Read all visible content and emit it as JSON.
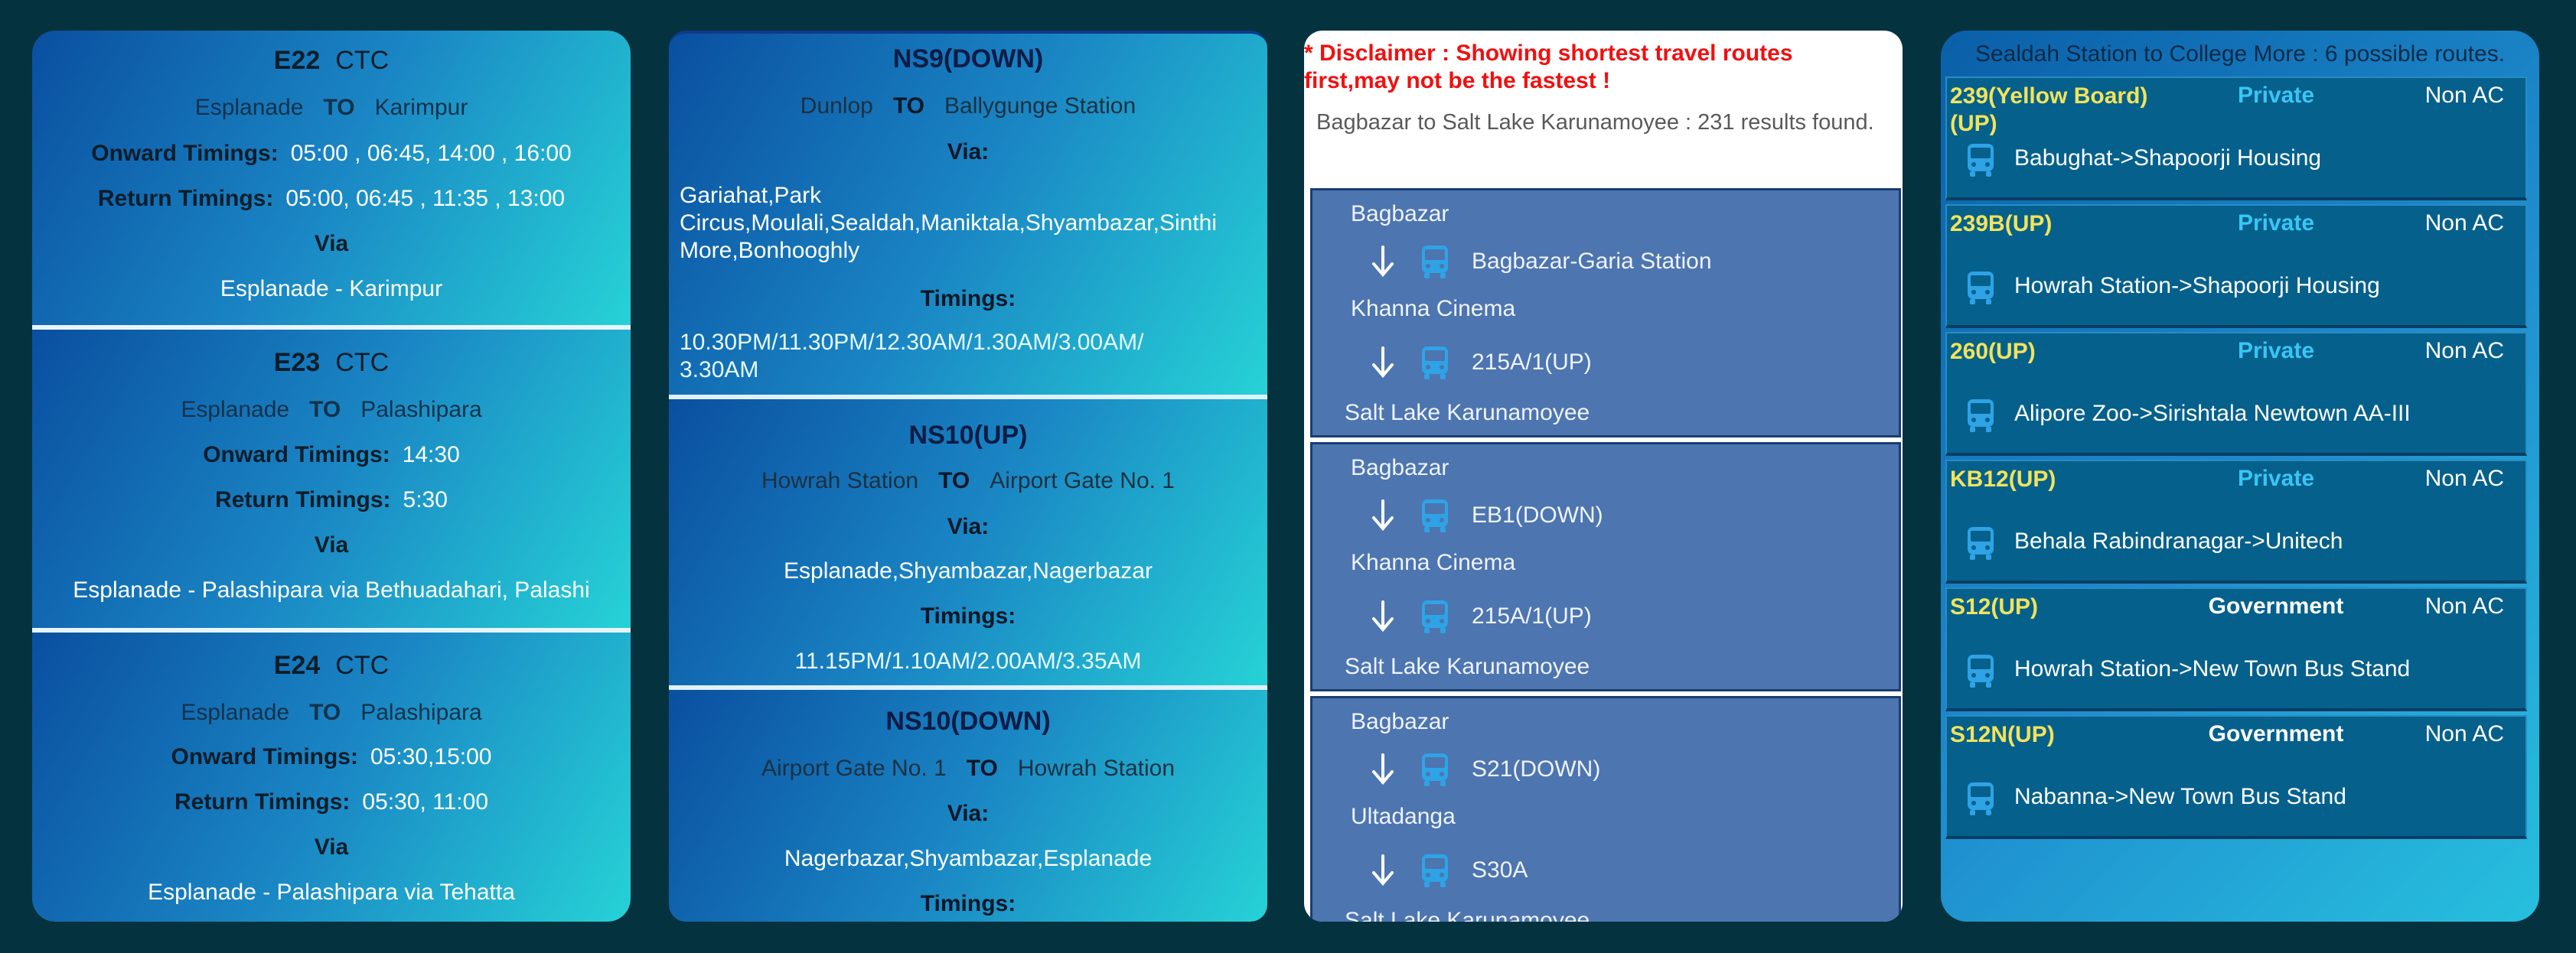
{
  "panel1": {
    "cards": [
      {
        "code": "E22",
        "operator": "CTC",
        "from": "Esplanade",
        "to_word": "TO",
        "to": "Karimpur",
        "onward_label": "Onward Timings:",
        "onward": "05:00 , 06:45, 14:00 , 16:00",
        "return_label": "Return Timings:",
        "return": "05:00, 06:45 , 11:35 , 13:00",
        "via_label": "Via",
        "via": "Esplanade - Karimpur"
      },
      {
        "code": "E23",
        "operator": "CTC",
        "from": "Esplanade",
        "to_word": "TO",
        "to": "Palashipara",
        "onward_label": "Onward Timings:",
        "onward": "14:30",
        "return_label": "Return Timings:",
        "return": "5:30",
        "via_label": "Via",
        "via": "Esplanade - Palashipara via Bethuadahari, Palashi"
      },
      {
        "code": "E24",
        "operator": "CTC",
        "from": "Esplanade",
        "to_word": "TO",
        "to": "Palashipara",
        "onward_label": "Onward Timings:",
        "onward": "05:30,15:00",
        "return_label": "Return Timings:",
        "return": "05:30, 11:00",
        "via_label": "Via",
        "via": "Esplanade - Palashipara via Tehatta"
      }
    ]
  },
  "panel2": {
    "cards": [
      {
        "title": "NS9(DOWN)",
        "from": "Dunlop",
        "to_word": "TO",
        "to": "Ballygunge Station",
        "via_label": "Via:",
        "via": "Gariahat,Park Circus,Moulali,Sealdah,Maniktala,Shyambazar,Sinthi More,Bonhooghly",
        "timings_label": "Timings:",
        "timings": "10.30PM/11.30PM/12.30AM/1.30AM/3.00AM/ 3.30AM"
      },
      {
        "title": "NS10(UP)",
        "from": "Howrah Station",
        "to_word": "TO",
        "to": "Airport Gate No. 1",
        "via_label": "Via:",
        "via": "Esplanade,Shyambazar,Nagerbazar",
        "timings_label": "Timings:",
        "timings": "11.15PM/1.10AM/2.00AM/3.35AM"
      },
      {
        "title": "NS10(DOWN)",
        "from": "Airport Gate No. 1",
        "to_word": "TO",
        "to": "Howrah Station",
        "via_label": "Via:",
        "via": "Nagerbazar,Shyambazar,Esplanade",
        "timings_label": "Timings:"
      }
    ]
  },
  "panel3": {
    "disclaimer": "* Disclaimer : Showing shortest travel routes first,may not be the fastest !",
    "results": "Bagbazar to Salt Lake Karunamoyee : 231 results found.",
    "routes": [
      {
        "stop1": "Bagbazar",
        "leg1": "Bagbazar-Garia Station",
        "stop2": "Khanna Cinema",
        "leg2": "215A/1(UP)",
        "stop3": "Salt Lake Karunamoyee"
      },
      {
        "stop1": "Bagbazar",
        "leg1": "EB1(DOWN)",
        "stop2": "Khanna Cinema",
        "leg2": "215A/1(UP)",
        "stop3": "Salt Lake Karunamoyee"
      },
      {
        "stop1": "Bagbazar",
        "leg1": "S21(DOWN)",
        "stop2": "Ultadanga",
        "leg2": "S30A",
        "stop3": "Salt Lake Karunamoyee"
      }
    ]
  },
  "panel4": {
    "header": "Sealdah Station to College More : 6 possible routes.",
    "buses": [
      {
        "route": "239(Yellow Board)(UP)",
        "type": "Private",
        "ac": "Non AC",
        "path": "Babughat->Shapoorji Housing"
      },
      {
        "route": "239B(UP)",
        "type": "Private",
        "ac": "Non AC",
        "path": "Howrah Station->Shapoorji Housing"
      },
      {
        "route": "260(UP)",
        "type": "Private",
        "ac": "Non AC",
        "path": "Alipore Zoo->Sirishtala Newtown AA-III"
      },
      {
        "route": "KB12(UP)",
        "type": "Private",
        "ac": "Non AC",
        "path": "Behala Rabindranagar->Unitech"
      },
      {
        "route": "S12(UP)",
        "type": "Government",
        "ac": "Non AC",
        "path": "Howrah Station->New Town Bus Stand"
      },
      {
        "route": "S12N(UP)",
        "type": "Government",
        "ac": "Non AC",
        "path": "Nabanna->New Town Bus Stand"
      }
    ]
  }
}
